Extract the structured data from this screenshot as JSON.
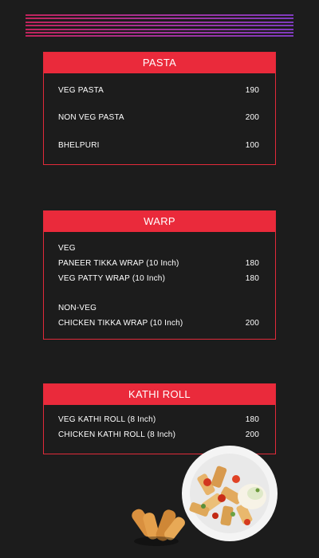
{
  "pasta": {
    "title": "PASTA",
    "items": [
      {
        "name": "VEG PASTA",
        "price": "190"
      },
      {
        "name": "NON VEG PASTA",
        "price": "200"
      },
      {
        "name": "BHELPURI",
        "price": "100"
      }
    ]
  },
  "warp": {
    "title": "WARP",
    "veg_label": "VEG",
    "nonveg_label": "NON-VEG",
    "items": [
      {
        "name": "PANEER TIKKA WRAP (10 Inch)",
        "price": "180"
      },
      {
        "name": "VEG PATTY WRAP (10 Inch)",
        "price": "180"
      },
      {
        "name": "CHICKEN TIKKA WRAP (10 Inch)",
        "price": "200"
      }
    ]
  },
  "kathi": {
    "title": "KATHI ROLL",
    "items": [
      {
        "name": "VEG KATHI ROLL (8 Inch)",
        "price": "180"
      },
      {
        "name": "CHICKEN KATHI ROLL (8 Inch)",
        "price": "200"
      }
    ]
  },
  "colors": {
    "background": "#1c1c1c",
    "accent_red": "#ea2a3b",
    "stripe_start": "#c0245c",
    "stripe_end": "#7f3bbf"
  },
  "images": {
    "pasta_plate": "pasta-plate-image",
    "fried_snacks": "fried-snacks-image"
  }
}
